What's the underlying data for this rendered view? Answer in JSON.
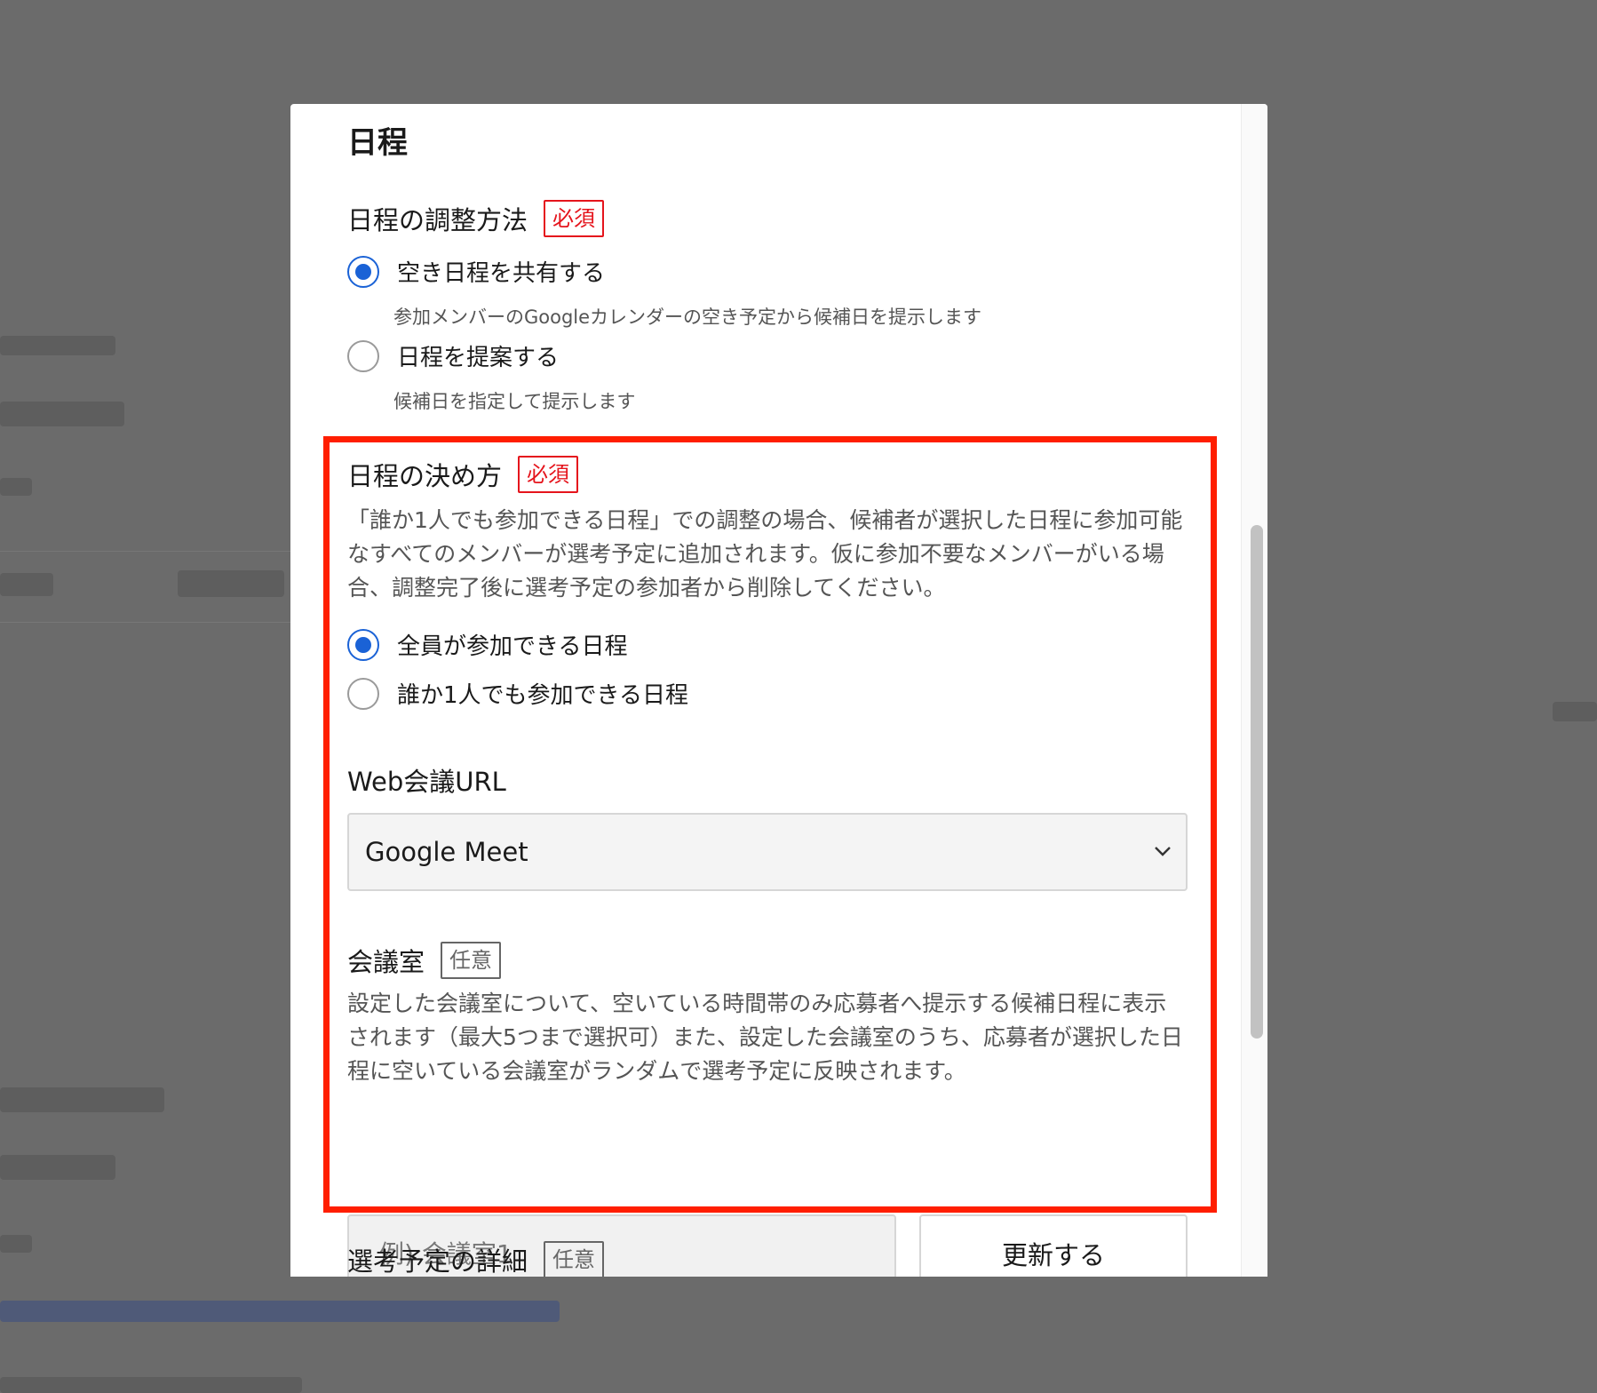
{
  "modal": {
    "title": "日程",
    "adjust_method": {
      "label": "日程の調整方法",
      "badge": "必須",
      "options": [
        {
          "label": "空き日程を共有する",
          "hint": "参加メンバーのGoogleカレンダーの空き予定から候補日を提示します",
          "checked": true
        },
        {
          "label": "日程を提案する",
          "hint": "候補日を指定して提示します",
          "checked": false
        }
      ]
    },
    "decide_method": {
      "label": "日程の決め方",
      "badge": "必須",
      "description": "「誰か1人でも参加できる日程」での調整の場合、候補者が選択した日程に参加可能なすべてのメンバーが選考予定に追加されます。仮に参加不要なメンバーがいる場合、調整完了後に選考予定の参加者から削除してください。",
      "options": [
        {
          "label": "全員が参加できる日程",
          "checked": true
        },
        {
          "label": "誰か1人でも参加できる日程",
          "checked": false
        }
      ]
    },
    "web_meeting": {
      "label": "Web会議URL",
      "selected": "Google Meet"
    },
    "meeting_room": {
      "label": "会議室",
      "badge": "任意",
      "description": "設定した会議室について、空いている時間帯のみ応募者へ提示する候補日程に表示されます（最大5つまで選択可）また、設定した会議室のうち、応募者が選択した日程に空いている会議室がランダムで選考予定に反映されます。",
      "placeholder": "例) 会議室1",
      "update_button": "更新する"
    },
    "next_section": {
      "label": "選考予定の詳細",
      "badge": "任意"
    }
  },
  "colors": {
    "accent": "#1a62d6",
    "required": "#e5141c",
    "highlight": "#ff1e00",
    "overlay": "#6b6b6b"
  }
}
